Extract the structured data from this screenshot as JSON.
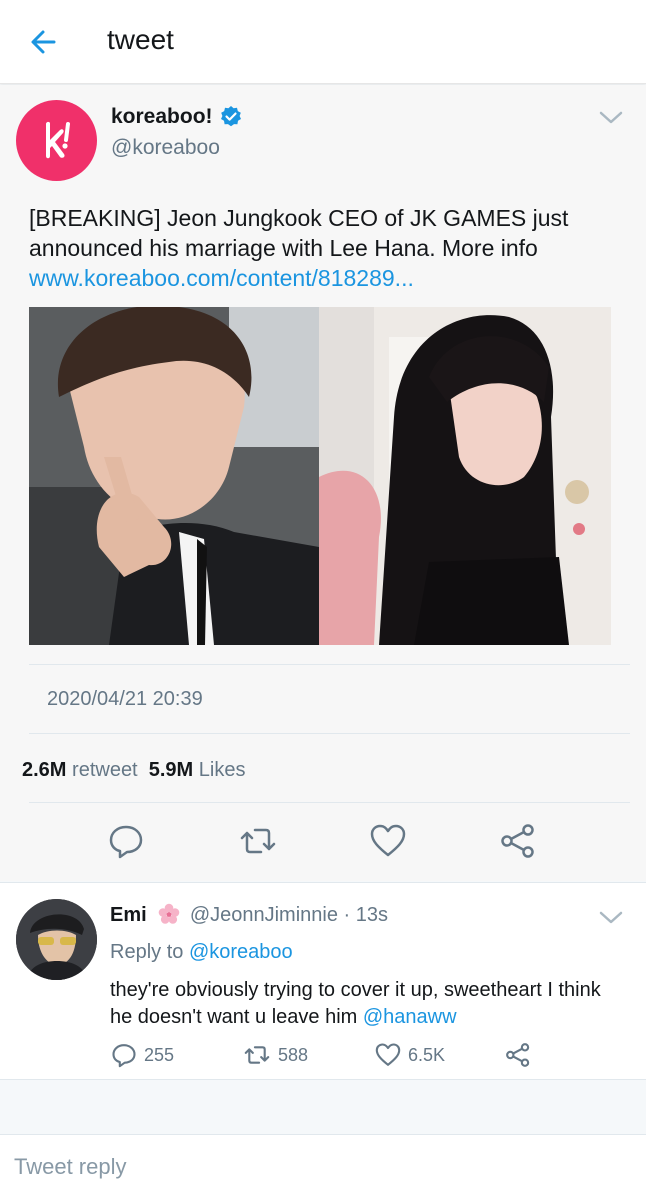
{
  "header": {
    "title": "tweet"
  },
  "tweet": {
    "author_name": "koreaboo!",
    "author_handle": "@koreaboo",
    "text": "[BREAKING] Jeon Jungkook CEO of JK GAMES just announced his marriage with Lee Hana. More info ",
    "link": "www.koreaboo.com/content/818289...",
    "timestamp": "2020/04/21 20:39",
    "retweet_count": "2.6M",
    "retweet_label": "retweet",
    "likes_count": "5.9M",
    "likes_label": "Likes"
  },
  "reply": {
    "name": "Emi",
    "handle_time": "@JeonnJiminnie · 13s",
    "reply_to_prefix": "Reply to ",
    "reply_to_handle": "@koreaboo",
    "text": "they're obviously trying to cover it up, sweetheart I think he doesn't want u leave him ",
    "mention": "@hanaww",
    "replies": "255",
    "retweets": "588",
    "likes": "6.5K"
  },
  "compose": {
    "placeholder": "Tweet reply"
  },
  "icons": {
    "back": "arrow-left-icon",
    "verified": "verified-badge-icon",
    "more": "chevron-down-icon",
    "reply": "speech-bubble-icon",
    "retweet": "retweet-icon",
    "like": "heart-icon",
    "share": "share-icon",
    "emoji": "cherry-blossom-icon"
  },
  "colors": {
    "accent": "#1b95e0",
    "brand_pink": "#f0306a",
    "muted": "#657786"
  }
}
